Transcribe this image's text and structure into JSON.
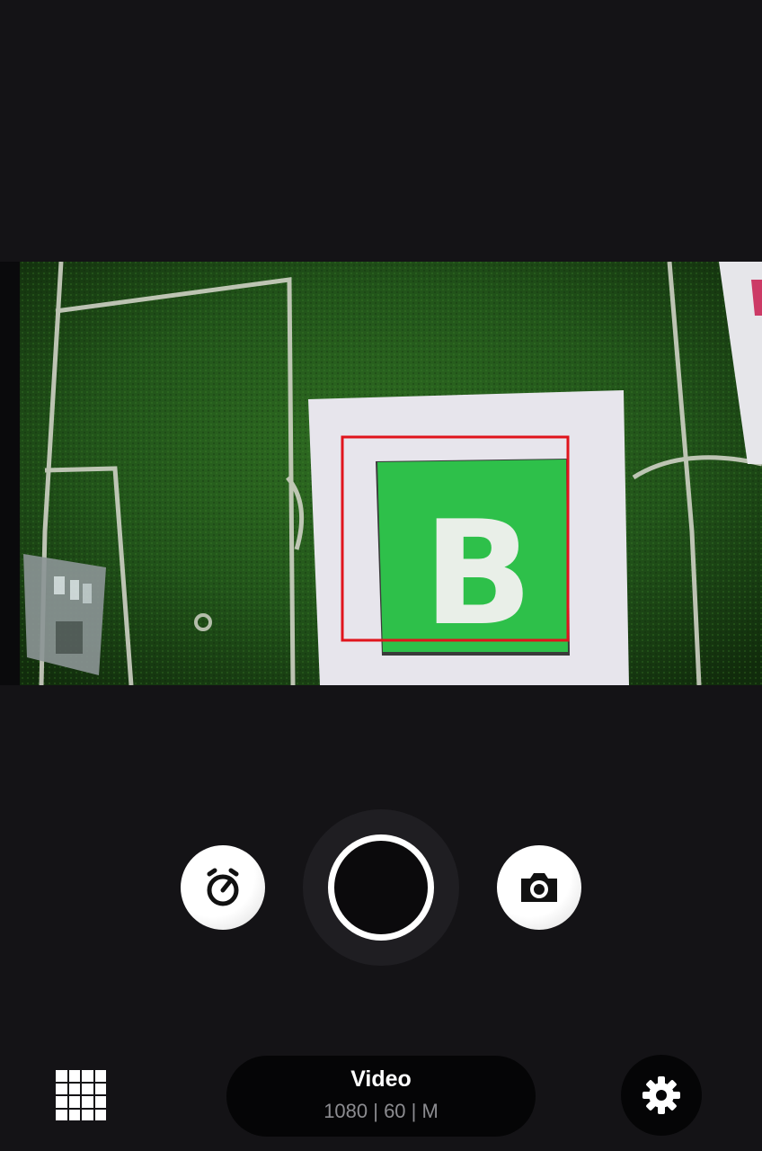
{
  "app": {
    "mode": "camera"
  },
  "preview": {
    "card_letter": "B",
    "detection_box_color": "#e0141c",
    "card_color": "#2ec04a"
  },
  "controls": {
    "timer_icon": "timer-icon",
    "shutter_icon": "record-icon",
    "photo_icon": "camera-icon"
  },
  "bottom_bar": {
    "grid_icon": "grid-icon",
    "mode_title": "Video",
    "mode_settings": "1080 | 60 | M",
    "settings_icon": "gear-icon"
  }
}
